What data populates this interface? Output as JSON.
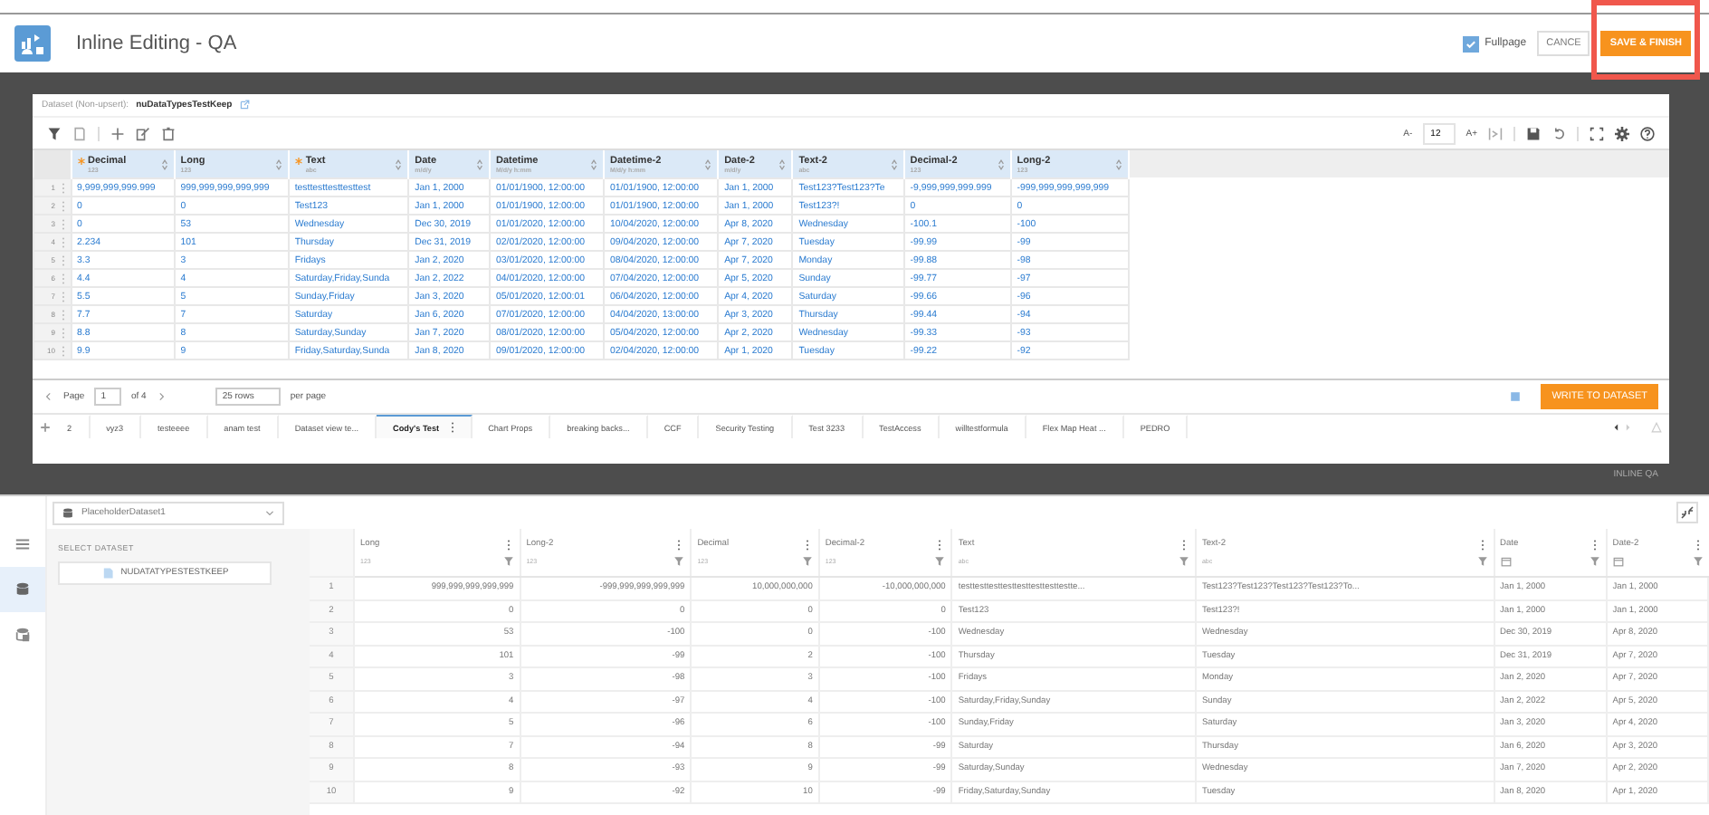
{
  "header": {
    "title": "Inline Editing - QA",
    "fullpage": {
      "label": "Fullpage",
      "checked": true
    },
    "cancel": "CANCE",
    "save": "SAVE & FINISH",
    "highlighted": true
  },
  "dataset": {
    "label": "Dataset (Non-upsert):",
    "name": "nuDataTypesTestKeep"
  },
  "font_size": {
    "decrease": "A-",
    "value": "12",
    "increase": "A+"
  },
  "grid": {
    "columns": [
      {
        "label": "Decimal",
        "sub": "123",
        "required": true
      },
      {
        "label": "Long",
        "sub": "123",
        "required": false
      },
      {
        "label": "Text",
        "sub": "abc",
        "required": true
      },
      {
        "label": "Date",
        "sub": "m/d/y",
        "required": false
      },
      {
        "label": "Datetime",
        "sub": "M/d/y h:mm",
        "required": false
      },
      {
        "label": "Datetime-2",
        "sub": "M/d/y h:mm",
        "required": false
      },
      {
        "label": "Date-2",
        "sub": "m/d/y",
        "required": false
      },
      {
        "label": "Text-2",
        "sub": "abc",
        "required": false
      },
      {
        "label": "Decimal-2",
        "sub": "123",
        "required": false
      },
      {
        "label": "Long-2",
        "sub": "123",
        "required": false
      }
    ],
    "rows": [
      {
        "num": "1",
        "cells": [
          "9,999,999,999.999",
          "999,999,999,999,999",
          "testtesttesttesttest",
          "Jan 1, 2000",
          "01/01/1900, 12:00:00",
          "01/01/1900, 12:00:00",
          "Jan 1, 2000",
          "Test123?Test123?Te",
          "-9,999,999,999.999",
          "-999,999,999,999,999"
        ]
      },
      {
        "num": "2",
        "cells": [
          "0",
          "0",
          "Test123",
          "Jan 1, 2000",
          "01/01/1900, 12:00:00",
          "01/01/1900, 12:00:00",
          "Jan 1, 2000",
          "Test123?!",
          "0",
          "0"
        ]
      },
      {
        "num": "3",
        "cells": [
          "0",
          "53",
          "Wednesday",
          "Dec 30, 2019",
          "01/01/2020, 12:00:00",
          "10/04/2020, 12:00:00",
          "Apr 8, 2020",
          "Wednesday",
          "-100.1",
          "-100"
        ]
      },
      {
        "num": "4",
        "cells": [
          "2.234",
          "101",
          "Thursday",
          "Dec 31, 2019",
          "02/01/2020, 12:00:00",
          "09/04/2020, 12:00:00",
          "Apr 7, 2020",
          "Tuesday",
          "-99.99",
          "-99"
        ]
      },
      {
        "num": "5",
        "cells": [
          "3.3",
          "3",
          "Fridays",
          "Jan 2, 2020",
          "03/01/2020, 12:00:00",
          "08/04/2020, 12:00:00",
          "Apr 7, 2020",
          "Monday",
          "-99.88",
          "-98"
        ]
      },
      {
        "num": "6",
        "cells": [
          "4.4",
          "4",
          "Saturday,Friday,Sunda",
          "Jan 2, 2022",
          "04/01/2020, 12:00:00",
          "07/04/2020, 12:00:00",
          "Apr 5, 2020",
          "Sunday",
          "-99.77",
          "-97"
        ]
      },
      {
        "num": "7",
        "cells": [
          "5.5",
          "5",
          "Sunday,Friday",
          "Jan 3, 2020",
          "05/01/2020, 12:00:01",
          "06/04/2020, 12:00:00",
          "Apr 4, 2020",
          "Saturday",
          "-99.66",
          "-96"
        ]
      },
      {
        "num": "8",
        "cells": [
          "7.7",
          "7",
          "Saturday",
          "Jan 6, 2020",
          "07/01/2020, 12:00:00",
          "04/04/2020, 13:00:00",
          "Apr 3, 2020",
          "Thursday",
          "-99.44",
          "-94"
        ]
      },
      {
        "num": "9",
        "cells": [
          "8.8",
          "8",
          "Saturday,Sunday",
          "Jan 7, 2020",
          "08/01/2020, 12:00:00",
          "05/04/2020, 12:00:00",
          "Apr 2, 2020",
          "Wednesday",
          "-99.33",
          "-93"
        ]
      },
      {
        "num": "10",
        "cells": [
          "9.9",
          "9",
          "Friday,Saturday,Sunda",
          "Jan 8, 2020",
          "09/01/2020, 12:00:00",
          "02/04/2020, 12:00:00",
          "Apr 1, 2020",
          "Tuesday",
          "-99.22",
          "-92"
        ]
      }
    ]
  },
  "paging": {
    "page_label": "Page",
    "page": "1",
    "of": "of 4",
    "rows": "25 rows",
    "per_page": "per page",
    "write_button": "WRITE TO DATASET"
  },
  "tabs": [
    {
      "label": "2",
      "selected": false
    },
    {
      "label": "vyz3",
      "selected": false
    },
    {
      "label": "testeeee",
      "selected": false
    },
    {
      "label": "anam test",
      "selected": false
    },
    {
      "label": "Dataset view te...",
      "selected": false
    },
    {
      "label": "Cody's Test",
      "selected": true
    },
    {
      "label": "Chart Props",
      "selected": false
    },
    {
      "label": "breaking backs...",
      "selected": false
    },
    {
      "label": "CCF",
      "selected": false
    },
    {
      "label": "Security Testing",
      "selected": false
    },
    {
      "label": "Test 3233",
      "selected": false
    },
    {
      "label": "TestAccess",
      "selected": false
    },
    {
      "label": "willtestformula",
      "selected": false
    },
    {
      "label": "Flex Map Heat ...",
      "selected": false
    },
    {
      "label": "PEDRO",
      "selected": false
    }
  ],
  "footer_label": "INLINE QA",
  "lower": {
    "rail": [
      {
        "kind": "menu",
        "selected": false
      },
      {
        "kind": "database",
        "selected": true
      },
      {
        "kind": "table",
        "selected": false
      }
    ],
    "dropdown": "PlaceholderDataset1",
    "select_label": "SELECT DATASET",
    "dataset_button": "NUDATATYPESTESTKEEP",
    "columns": [
      {
        "label": "Long",
        "kind": "number",
        "sub": "123"
      },
      {
        "label": "Long-2",
        "kind": "number",
        "sub": "123"
      },
      {
        "label": "Decimal",
        "kind": "number",
        "sub": "123"
      },
      {
        "label": "Decimal-2",
        "kind": "number",
        "sub": "123"
      },
      {
        "label": "Text",
        "kind": "text",
        "sub": "abc"
      },
      {
        "label": "Text-2",
        "kind": "text",
        "sub": "abc"
      },
      {
        "label": "Date",
        "kind": "date"
      },
      {
        "label": "Date-2",
        "kind": "date"
      }
    ],
    "rows": [
      {
        "num": "1",
        "cells": [
          "999,999,999,999,999",
          "-999,999,999,999,999",
          "10,000,000,000",
          "-10,000,000,000",
          "testtesttesttesttesttesttesttestte...",
          "Test123?Test123?Test123?Test123?To...",
          "Jan 1, 2000",
          "Jan 1, 2000"
        ]
      },
      {
        "num": "2",
        "cells": [
          "0",
          "0",
          "0",
          "0",
          "Test123",
          "Test123?!",
          "Jan 1, 2000",
          "Jan 1, 2000"
        ]
      },
      {
        "num": "3",
        "cells": [
          "53",
          "-100",
          "0",
          "-100",
          "Wednesday",
          "Wednesday",
          "Dec 30, 2019",
          "Apr 8, 2020"
        ]
      },
      {
        "num": "4",
        "cells": [
          "101",
          "-99",
          "2",
          "-100",
          "Thursday",
          "Tuesday",
          "Dec 31, 2019",
          "Apr 7, 2020"
        ]
      },
      {
        "num": "5",
        "cells": [
          "3",
          "-98",
          "3",
          "-100",
          "Fridays",
          "Monday",
          "Jan 2, 2020",
          "Apr 7, 2020"
        ]
      },
      {
        "num": "6",
        "cells": [
          "4",
          "-97",
          "4",
          "-100",
          "Saturday,Friday,Sunday",
          "Sunday",
          "Jan 2, 2022",
          "Apr 5, 2020"
        ]
      },
      {
        "num": "7",
        "cells": [
          "5",
          "-96",
          "6",
          "-100",
          "Sunday,Friday",
          "Saturday",
          "Jan 3, 2020",
          "Apr 4, 2020"
        ]
      },
      {
        "num": "8",
        "cells": [
          "7",
          "-94",
          "8",
          "-99",
          "Saturday",
          "Thursday",
          "Jan 6, 2020",
          "Apr 3, 2020"
        ]
      },
      {
        "num": "9",
        "cells": [
          "8",
          "-93",
          "9",
          "-99",
          "Saturday,Sunday",
          "Wednesday",
          "Jan 7, 2020",
          "Apr 2, 2020"
        ]
      },
      {
        "num": "10",
        "cells": [
          "9",
          "-92",
          "10",
          "-99",
          "Friday,Saturday,Sunday",
          "Tuesday",
          "Jan 8, 2020",
          "Apr 1, 2020"
        ]
      }
    ]
  }
}
